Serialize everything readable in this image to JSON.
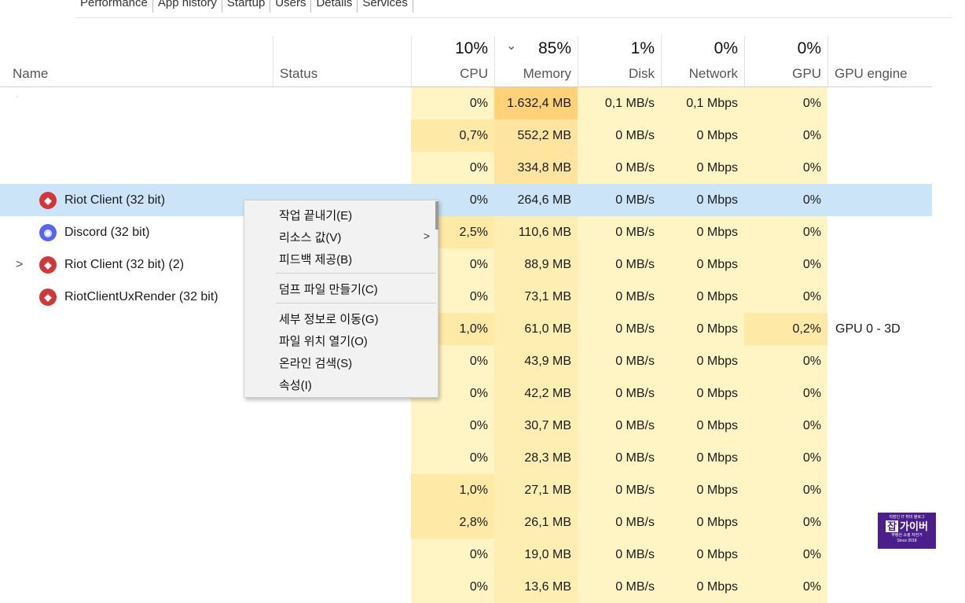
{
  "tabs": [
    "Performance",
    "App history",
    "Startup",
    "Users",
    "Details",
    "Services"
  ],
  "header": {
    "name": "Name",
    "status": "Status",
    "cpu": {
      "pct": "10%",
      "label": "CPU"
    },
    "memory": {
      "pct": "85%",
      "label": "Memory",
      "sort_icon": "chevron-down-icon"
    },
    "disk": {
      "pct": "1%",
      "label": "Disk"
    },
    "network": {
      "pct": "0%",
      "label": "Network"
    },
    "gpu": {
      "pct": "0%",
      "label": "GPU"
    },
    "gpu_engine": "GPU engine"
  },
  "rows": [
    {
      "name": "",
      "cpu": "0%",
      "mem": "1.632,4 MB",
      "disk": "0,1 MB/s",
      "net": "0,1 Mbps",
      "gpu": "0%",
      "eng": ""
    },
    {
      "name": "",
      "cpu": "0,7%",
      "mem": "552,2 MB",
      "disk": "0 MB/s",
      "net": "0 Mbps",
      "gpu": "0%",
      "eng": ""
    },
    {
      "name": "",
      "cpu": "0%",
      "mem": "334,8 MB",
      "disk": "0 MB/s",
      "net": "0 Mbps",
      "gpu": "0%",
      "eng": ""
    },
    {
      "name": "Riot Client (32 bit)",
      "icon": "riot-icon",
      "cpu": "0%",
      "mem": "264,6 MB",
      "disk": "0 MB/s",
      "net": "0 Mbps",
      "gpu": "0%",
      "eng": "",
      "selected": true
    },
    {
      "name": "Discord (32 bit)",
      "icon": "discord-icon",
      "cpu": "2,5%",
      "mem": "110,6 MB",
      "disk": "0 MB/s",
      "net": "0 Mbps",
      "gpu": "0%",
      "eng": ""
    },
    {
      "name": "Riot Client (32 bit) (2)",
      "icon": "riot-icon",
      "expander": ">",
      "cpu": "0%",
      "mem": "88,9 MB",
      "disk": "0 MB/s",
      "net": "0 Mbps",
      "gpu": "0%",
      "eng": ""
    },
    {
      "name": "RiotClientUxRender (32 bit)",
      "icon": "riot-icon",
      "cpu": "0%",
      "mem": "73,1 MB",
      "disk": "0 MB/s",
      "net": "0 Mbps",
      "gpu": "0%",
      "eng": ""
    },
    {
      "name": "",
      "cpu": "1,0%",
      "mem": "61,0 MB",
      "disk": "0 MB/s",
      "net": "0 Mbps",
      "gpu": "0,2%",
      "eng": "GPU 0 - 3D"
    },
    {
      "name": "",
      "cpu": "0%",
      "mem": "43,9 MB",
      "disk": "0 MB/s",
      "net": "0 Mbps",
      "gpu": "0%",
      "eng": ""
    },
    {
      "name": "",
      "cpu": "0%",
      "mem": "42,2 MB",
      "disk": "0 MB/s",
      "net": "0 Mbps",
      "gpu": "0%",
      "eng": ""
    },
    {
      "name": "",
      "cpu": "0%",
      "mem": "30,7 MB",
      "disk": "0 MB/s",
      "net": "0 Mbps",
      "gpu": "0%",
      "eng": ""
    },
    {
      "name": "",
      "cpu": "0%",
      "mem": "28,3 MB",
      "disk": "0 MB/s",
      "net": "0 Mbps",
      "gpu": "0%",
      "eng": ""
    },
    {
      "name": "",
      "cpu": "1,0%",
      "mem": "27,1 MB",
      "disk": "0 MB/s",
      "net": "0 Mbps",
      "gpu": "0%",
      "eng": ""
    },
    {
      "name": "",
      "cpu": "2,8%",
      "mem": "26,1 MB",
      "disk": "0 MB/s",
      "net": "0 Mbps",
      "gpu": "0%",
      "eng": ""
    },
    {
      "name": "",
      "cpu": "0%",
      "mem": "19,0 MB",
      "disk": "0 MB/s",
      "net": "0 Mbps",
      "gpu": "0%",
      "eng": ""
    },
    {
      "name": "",
      "cpu": "0%",
      "mem": "13,6 MB",
      "disk": "0 MB/s",
      "net": "0 Mbps",
      "gpu": "0%",
      "eng": ""
    }
  ],
  "context_menu": {
    "items": [
      {
        "label": "작업 끝내기(E)"
      },
      {
        "label": "리소스 값(V)",
        "submenu": ">"
      },
      {
        "label": "피드백 제공(B)"
      },
      {
        "label": "덤프 파일 만들기(C)"
      },
      {
        "label": "세부 정보로 이동(G)"
      },
      {
        "label": "파일 위치 열기(O)"
      },
      {
        "label": "온라인 검색(S)"
      },
      {
        "label": "속성(I)"
      }
    ]
  },
  "watermark": {
    "line1": "직장인 IT 취미 블로그",
    "box": "잡",
    "line2": "가이버",
    "line3": "부평산 쇼핑 자전거",
    "line4": "Since 2018"
  },
  "colors": {
    "selected_row": "#cce4f7",
    "heat_light": "#fff4c4",
    "heat_mid": "#ffe9a6",
    "heat_strong": "#ffd27a",
    "watermark_bg": "#4a1f8c"
  }
}
